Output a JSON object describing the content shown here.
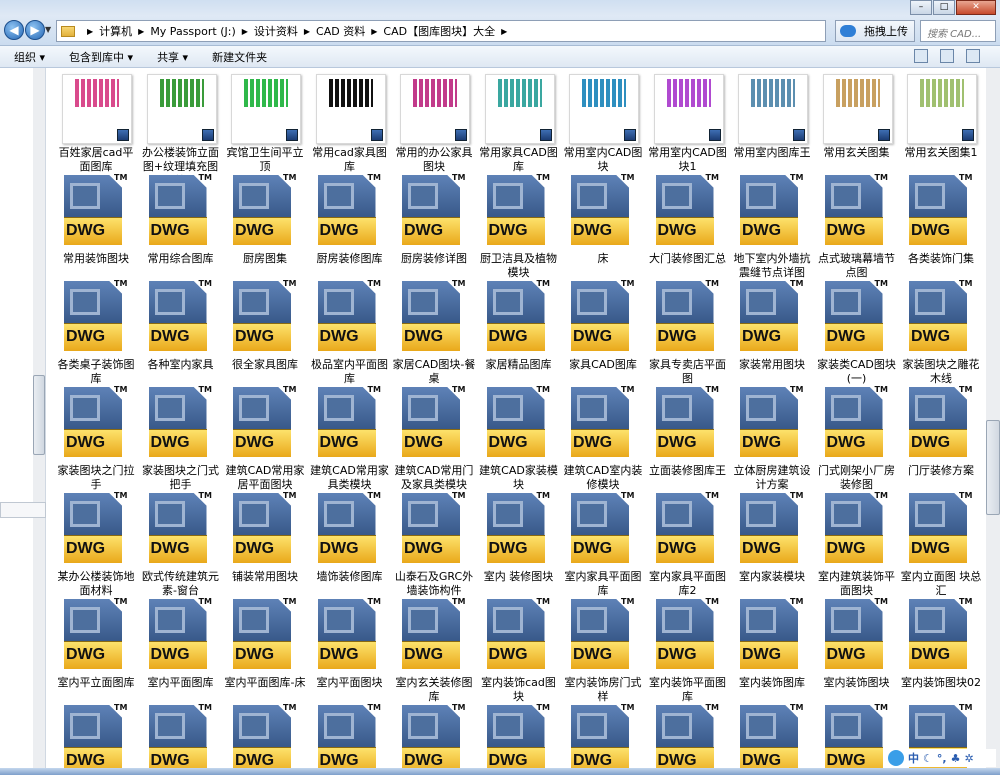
{
  "address": {
    "crumbs": [
      "计算机",
      "My Passport (J:)",
      "设计资料",
      "CAD 资料",
      "CAD【图库图块】大全"
    ],
    "upload_label": "拖拽上传",
    "search_placeholder": "搜索 CAD..."
  },
  "toolbar": {
    "organize": "组织 ▾",
    "include": "包含到库中 ▾",
    "share": "共享 ▾",
    "new_folder": "新建文件夹"
  },
  "tray": {
    "ime": "中"
  },
  "files": [
    {
      "label": "百姓家居cad平面图库",
      "kind": "thumb",
      "color": "#d94a8c"
    },
    {
      "label": "办公楼装饰立面图+纹理填充图块",
      "kind": "thumb",
      "color": "#3a9b3a"
    },
    {
      "label": "宾馆卫生间平立顶",
      "kind": "thumb",
      "color": "#2fb84a"
    },
    {
      "label": "常用cad家具图库",
      "kind": "thumb",
      "color": "#111111"
    },
    {
      "label": "常用的办公家具图块",
      "kind": "thumb",
      "color": "#c23a8a"
    },
    {
      "label": "常用家具CAD图库",
      "kind": "thumb",
      "color": "#3aa7a0"
    },
    {
      "label": "常用室内CAD图块",
      "kind": "thumb",
      "color": "#2e8fbf"
    },
    {
      "label": "常用室内CAD图块1",
      "kind": "thumb",
      "color": "#b04ad0"
    },
    {
      "label": "常用室内图库王",
      "kind": "thumb",
      "color": "#5c8fb0"
    },
    {
      "label": "常用玄关图集",
      "kind": "thumb",
      "color": "#c8a060"
    },
    {
      "label": "常用玄关图集1",
      "kind": "thumb",
      "color": "#a0c070"
    },
    {
      "label": "常用装饰图块",
      "kind": "dwg"
    },
    {
      "label": "常用综合图库",
      "kind": "dwg"
    },
    {
      "label": "厨房图集",
      "kind": "dwg"
    },
    {
      "label": "厨房装修图库",
      "kind": "dwg"
    },
    {
      "label": "厨房装修详图",
      "kind": "dwg"
    },
    {
      "label": "厨卫洁具及植物模块",
      "kind": "dwg"
    },
    {
      "label": "床",
      "kind": "dwg"
    },
    {
      "label": "大门装修图汇总",
      "kind": "dwg"
    },
    {
      "label": "地下室内外墙抗震缝节点详图",
      "kind": "dwg"
    },
    {
      "label": "点式玻璃幕墙节点图",
      "kind": "dwg"
    },
    {
      "label": "各类装饰门集",
      "kind": "dwg"
    },
    {
      "label": "各类桌子装饰图库",
      "kind": "dwg"
    },
    {
      "label": "各种室内家具",
      "kind": "dwg"
    },
    {
      "label": "很全家具图库",
      "kind": "dwg"
    },
    {
      "label": "极品室内平面图库",
      "kind": "dwg"
    },
    {
      "label": "家居CAD图块-餐桌",
      "kind": "dwg"
    },
    {
      "label": "家居精品图库",
      "kind": "dwg"
    },
    {
      "label": "家具CAD图库",
      "kind": "dwg"
    },
    {
      "label": "家具专卖店平面图",
      "kind": "dwg"
    },
    {
      "label": "家装常用图块",
      "kind": "dwg"
    },
    {
      "label": "家装类CAD图块(一)",
      "kind": "dwg"
    },
    {
      "label": "家装图块之雕花木线",
      "kind": "dwg"
    },
    {
      "label": "家装图块之门拉手",
      "kind": "dwg"
    },
    {
      "label": "家装图块之门式把手",
      "kind": "dwg"
    },
    {
      "label": "建筑CAD常用家居平面图块",
      "kind": "dwg"
    },
    {
      "label": "建筑CAD常用家具类模块",
      "kind": "dwg"
    },
    {
      "label": "建筑CAD常用门及家具类模块",
      "kind": "dwg"
    },
    {
      "label": "建筑CAD家装模块",
      "kind": "dwg"
    },
    {
      "label": "建筑CAD室内装修模块",
      "kind": "dwg"
    },
    {
      "label": "立面装修图库王",
      "kind": "dwg"
    },
    {
      "label": "立体厨房建筑设计方案",
      "kind": "dwg"
    },
    {
      "label": "门式刚架小厂房装修图",
      "kind": "dwg"
    },
    {
      "label": "门厅装修方案",
      "kind": "dwg"
    },
    {
      "label": "某办公楼装饰地面材料",
      "kind": "dwg"
    },
    {
      "label": "欧式传统建筑元素-窗台",
      "kind": "dwg"
    },
    {
      "label": "铺装常用图块",
      "kind": "dwg"
    },
    {
      "label": "墙饰装修图库",
      "kind": "dwg"
    },
    {
      "label": "山泰石及GRC外墙装饰构件",
      "kind": "dwg"
    },
    {
      "label": "室内 装修图块",
      "kind": "dwg"
    },
    {
      "label": "室内家具平面图库",
      "kind": "dwg"
    },
    {
      "label": "室内家具平面图库2",
      "kind": "dwg"
    },
    {
      "label": "室内家装模块",
      "kind": "dwg"
    },
    {
      "label": "室内建筑装饰平面图块",
      "kind": "dwg"
    },
    {
      "label": "室内立面图 块总汇",
      "kind": "dwg"
    },
    {
      "label": "室内平立面图库",
      "kind": "dwg"
    },
    {
      "label": "室内平面图库",
      "kind": "dwg"
    },
    {
      "label": "室内平面图库-床",
      "kind": "dwg"
    },
    {
      "label": "室内平面图块",
      "kind": "dwg"
    },
    {
      "label": "室内玄关装修图库",
      "kind": "dwg"
    },
    {
      "label": "室内装饰cad图块",
      "kind": "dwg"
    },
    {
      "label": "室内装饰房门式样",
      "kind": "dwg"
    },
    {
      "label": "室内装饰平面图库",
      "kind": "dwg"
    },
    {
      "label": "室内装饰图库",
      "kind": "dwg"
    },
    {
      "label": "室内装饰图块",
      "kind": "dwg"
    },
    {
      "label": "室内装饰图块02",
      "kind": "dwg"
    },
    {
      "label": "",
      "kind": "dwg"
    },
    {
      "label": "",
      "kind": "dwg"
    },
    {
      "label": "",
      "kind": "dwg"
    },
    {
      "label": "",
      "kind": "dwg"
    },
    {
      "label": "",
      "kind": "dwg"
    },
    {
      "label": "",
      "kind": "dwg"
    },
    {
      "label": "",
      "kind": "dwg"
    },
    {
      "label": "",
      "kind": "dwg"
    },
    {
      "label": "",
      "kind": "dwg"
    },
    {
      "label": "",
      "kind": "dwg"
    },
    {
      "label": "",
      "kind": "dwg"
    }
  ],
  "dwg_icon": {
    "badge": "DWG",
    "tm": "TM"
  }
}
